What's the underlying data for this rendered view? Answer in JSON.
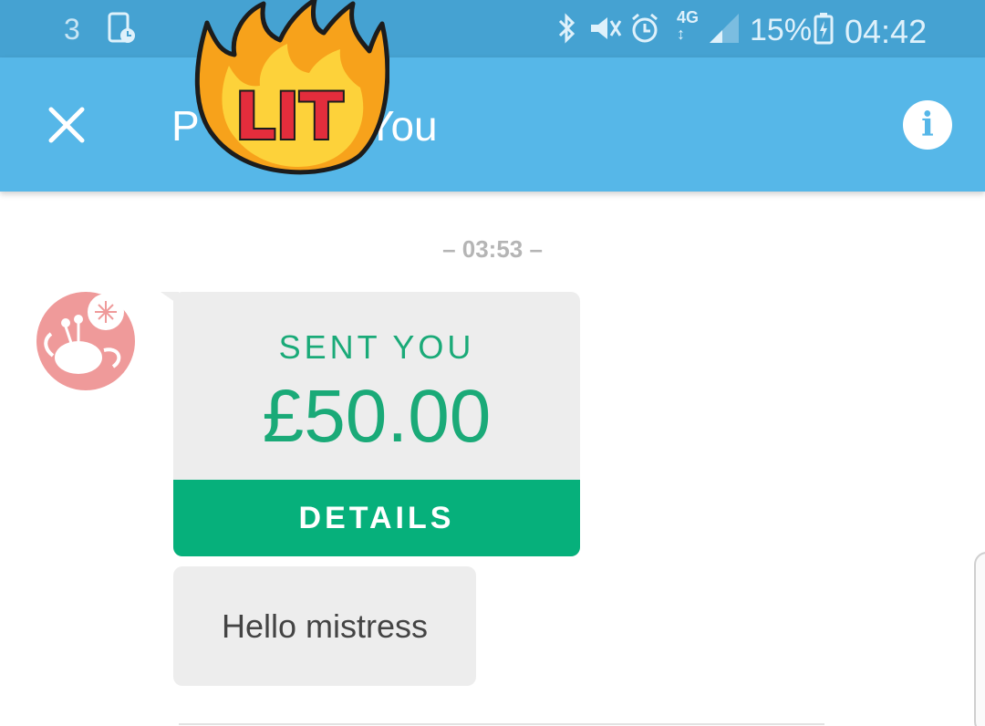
{
  "status_bar": {
    "carrier": "3",
    "network": "4G",
    "battery": "15%",
    "time": "04:42",
    "icons": [
      "carrier-icon",
      "screenshot-icon",
      "bluetooth-icon",
      "vibrate-icon",
      "alarm-icon",
      "data-icon",
      "signal-icon",
      "battery-icon"
    ]
  },
  "header": {
    "title_start": "P",
    "title_end": "You",
    "close_icon": "close-icon",
    "info_icon": "info-icon",
    "info_glyph": "i"
  },
  "sticker": {
    "text": "LIT"
  },
  "chat": {
    "timestamp": "– 03:53 –",
    "payment": {
      "label": "SENT YOU",
      "amount": "£50.00",
      "button": "DETAILS"
    },
    "message": "Hello mistress"
  },
  "colors": {
    "status_bar": "#45a2d2",
    "app_bar": "#56b7e8",
    "accent_green": "#06b07b",
    "text_green": "#1aaa78",
    "bubble_bg": "#ededed"
  }
}
